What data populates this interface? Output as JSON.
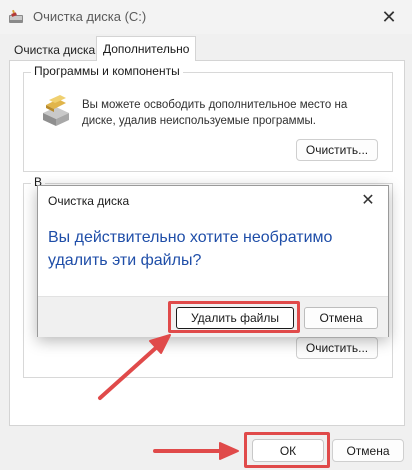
{
  "window": {
    "title": "Очистка диска  (C:)",
    "close_glyph": "✕"
  },
  "tabs": [
    {
      "label": "Очистка диска"
    },
    {
      "label": "Дополнительно"
    }
  ],
  "programs_group": {
    "title": "Программы и компоненты",
    "description": "Вы можете освободить дополнительное место на диске, удалив неиспользуемые программы.",
    "button_label": "Очистить..."
  },
  "second_group": {
    "title_visible": "В",
    "button_label": "Очистить..."
  },
  "dialog": {
    "title": "Очистка диска",
    "close_glyph": "✕",
    "message": "Вы действительно хотите необратимо удалить эти файлы?",
    "confirm_label": "Удалить файлы",
    "cancel_label": "Отмена"
  },
  "footer": {
    "ok_label": "ОК",
    "cancel_label": "Отмена"
  },
  "colors": {
    "accent_message": "#1f4ea8",
    "annotation": "#e04a4a"
  },
  "icons": {
    "app": "disk-cleanup-icon",
    "programs": "programs-components-icon"
  }
}
